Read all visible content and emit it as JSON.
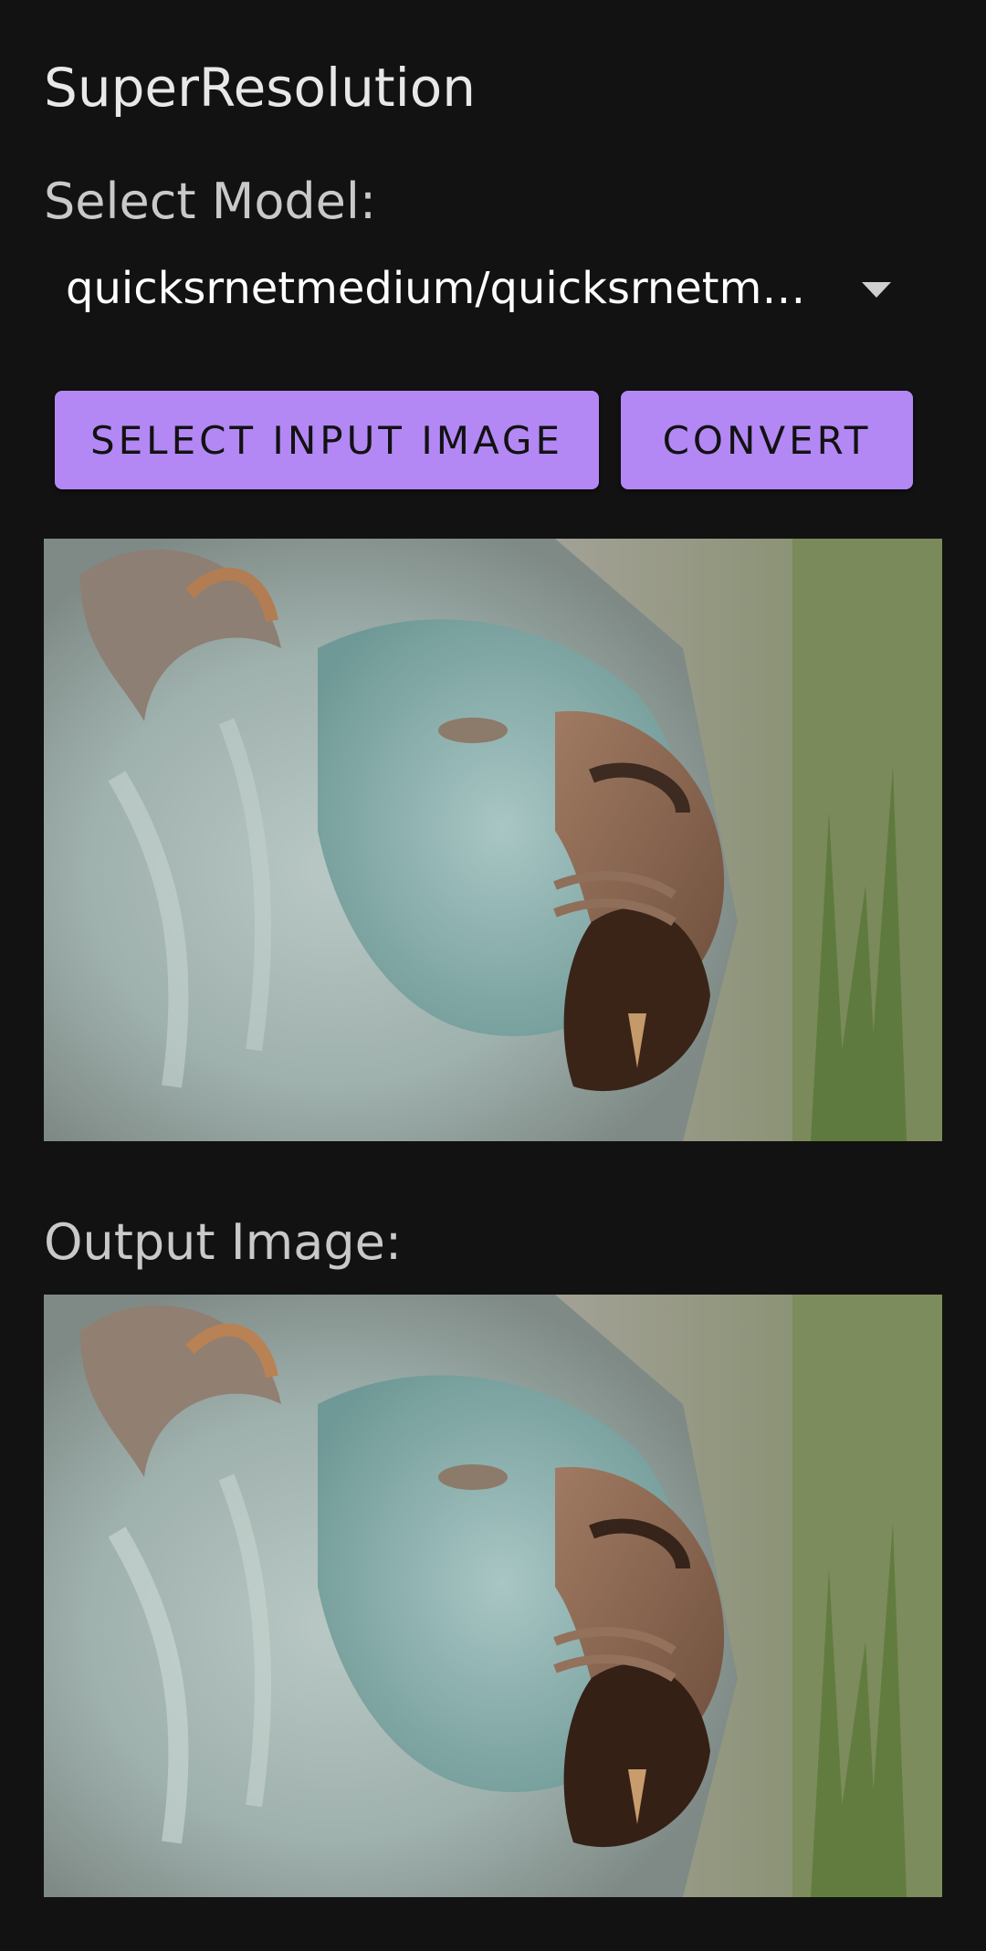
{
  "app": {
    "title": "SuperResolution"
  },
  "model_selector": {
    "label": "Select Model:",
    "selected_value": "quicksrnetmedium/quicksrnetmedium.tflite"
  },
  "buttons": {
    "select_input_label": "SELECT INPUT IMAGE",
    "convert_label": "CONVERT"
  },
  "output": {
    "label": "Output Image:"
  },
  "images": {
    "input_subject": "lion-statue-photo",
    "output_subject": "lion-statue-photo-upscaled"
  },
  "colors": {
    "background": "#121212",
    "button_accent": "#b388f5",
    "button_text": "#121212"
  }
}
